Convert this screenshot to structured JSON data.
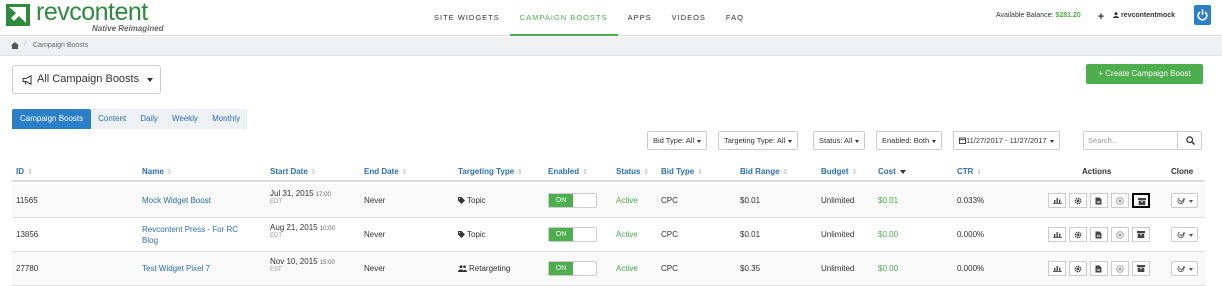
{
  "brand": {
    "name": "revcontent",
    "tagline": "Native Reimagined",
    "accent": "#4cae4c",
    "primary": "#2a7fc9"
  },
  "nav": {
    "items": [
      "SITE WIDGETS",
      "CAMPAIGN BOOSTS",
      "APPS",
      "VIDEOS",
      "FAQ"
    ],
    "active_index": 1
  },
  "account": {
    "balance_label": "Available Balance:",
    "balance_value": "$281.20",
    "plus_label": "+",
    "username": "revcontentmock",
    "user_icon": "user-icon",
    "power_icon": "power-icon"
  },
  "breadcrumb": {
    "home_icon": "home-icon",
    "separator": "/",
    "current": "Campaign Boosts"
  },
  "header": {
    "selector_icon": "megaphone-icon",
    "selector_label": "All Campaign Boosts",
    "create_label": "+ Create Campaign Boost"
  },
  "tabs": [
    "Campaign Boosts",
    "Content",
    "Daily",
    "Weekly",
    "Monthly"
  ],
  "filters": {
    "bid_type": "Bid Type: All",
    "targeting_type": "Targeting Type: All",
    "status": "Status: All",
    "enabled": "Enabled: Both",
    "date_range": "11/27/2017 - 11/27/2017",
    "search_placeholder": "Search..."
  },
  "table": {
    "columns": [
      "ID",
      "Name",
      "Start Date",
      "End Date",
      "Targeting Type",
      "Enabled",
      "Status",
      "Bid Type",
      "Bid Range",
      "Budget",
      "Cost",
      "CTR",
      "Actions",
      "Clone"
    ],
    "rows": [
      {
        "id": "11565",
        "name": "Mock Widget Boost",
        "start_date": "Jul 31, 2015",
        "start_time": "17:00",
        "tz": "EDT",
        "end_date": "Never",
        "targeting": "Topic",
        "targeting_icon": "tag-icon",
        "enabled": "ON",
        "status": "Active",
        "bid_type": "CPC",
        "bid_range": "$0.01",
        "budget": "Unlimited",
        "cost": "$0.01",
        "ctr": "0.033%"
      },
      {
        "id": "13856",
        "name": "Revcontent Press - For RC Blog",
        "start_date": "Aug 21, 2015",
        "start_time": "10:00",
        "tz": "EDT",
        "end_date": "Never",
        "targeting": "Topic",
        "targeting_icon": "tag-icon",
        "enabled": "ON",
        "status": "Active",
        "bid_type": "CPC",
        "bid_range": "$0.01",
        "budget": "Unlimited",
        "cost": "$0.00",
        "ctr": "0.000%"
      },
      {
        "id": "27780",
        "name": "Test Widget Pixel 7",
        "start_date": "Nov 10, 2015",
        "start_time": "15:00",
        "tz": "EST",
        "end_date": "Never",
        "targeting": "Retargeting",
        "targeting_icon": "users-icon",
        "enabled": "ON",
        "status": "Active",
        "bid_type": "CPC",
        "bid_range": "$0.35",
        "budget": "Unlimited",
        "cost": "$0.00",
        "ctr": "0.000%"
      }
    ]
  }
}
